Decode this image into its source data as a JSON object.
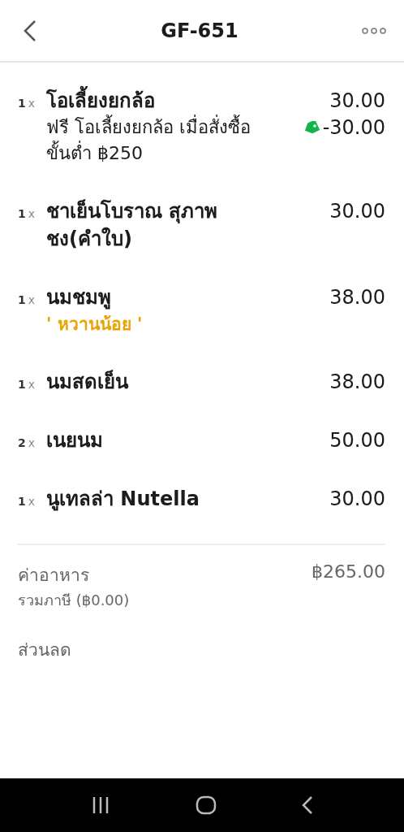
{
  "header": {
    "title": "GF-651"
  },
  "items": [
    {
      "quantity": "1",
      "times": "x",
      "name": "โอเลี้ยงยกล้อ",
      "price": "30.00",
      "notes": [
        {
          "kind": "discount",
          "text": "ฟรี โอเลี้ยงยกล้อ เมื่อสั่งซื้อขั้นต่ำ ฿250",
          "amount": "-30.00"
        }
      ]
    },
    {
      "quantity": "1",
      "times": "x",
      "name": "ชาเย็นโบราณ สุภาพชง(คำใบ)",
      "price": "30.00"
    },
    {
      "quantity": "1",
      "times": "x",
      "name": "นมชมพู",
      "price": "38.00",
      "notes": [
        {
          "kind": "option",
          "text": "' หวานน้อย '"
        }
      ]
    },
    {
      "quantity": "1",
      "times": "x",
      "name": "นมสดเย็น",
      "price": "38.00"
    },
    {
      "quantity": "2",
      "times": "x",
      "name": "เนยนม",
      "price": "50.00"
    },
    {
      "quantity": "1",
      "times": "x",
      "name": "นูเทลล่า Nutella",
      "price": "30.00"
    }
  ],
  "summary": {
    "label": "ค่าอาหาร",
    "sublabel": "รวมภาษี (฿0.00)",
    "amount": "฿265.00",
    "next_label": "ส่วนลด"
  }
}
